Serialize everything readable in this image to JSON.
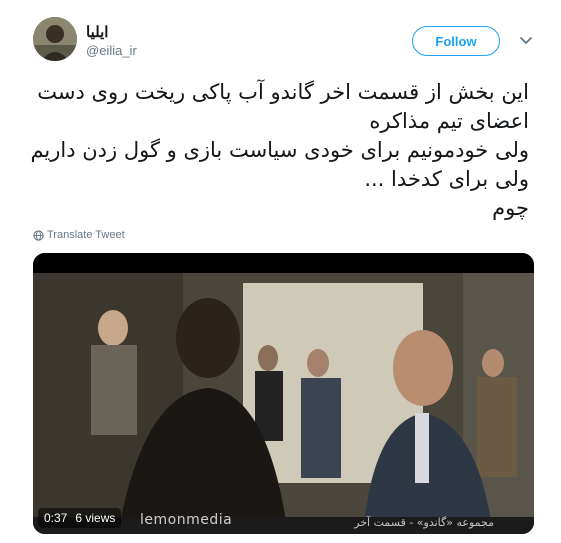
{
  "tweet": {
    "display_name": "ایلیا",
    "handle": "@eilia_ir",
    "follow_label": "Follow",
    "text_lines": [
      "این بخش از قسمت اخر گاندو آب پاکی ریخت روی دست",
      "اعضای تیم  مذاکره",
      "ولی خودمونیم برای خودی سیاست بازی و گول زدن داریم",
      "ولی برای کدخدا ...",
      "چوم"
    ],
    "translate_label": "Translate Tweet"
  },
  "video": {
    "time": "0:37",
    "views": "6 views",
    "watermark": "lemonmedia",
    "lower_third": "مجموعه «گاندو» - قسمت آخر"
  },
  "colors": {
    "accent": "#1da1f2",
    "secondary_text": "#657786",
    "primary_text": "#14171a"
  }
}
